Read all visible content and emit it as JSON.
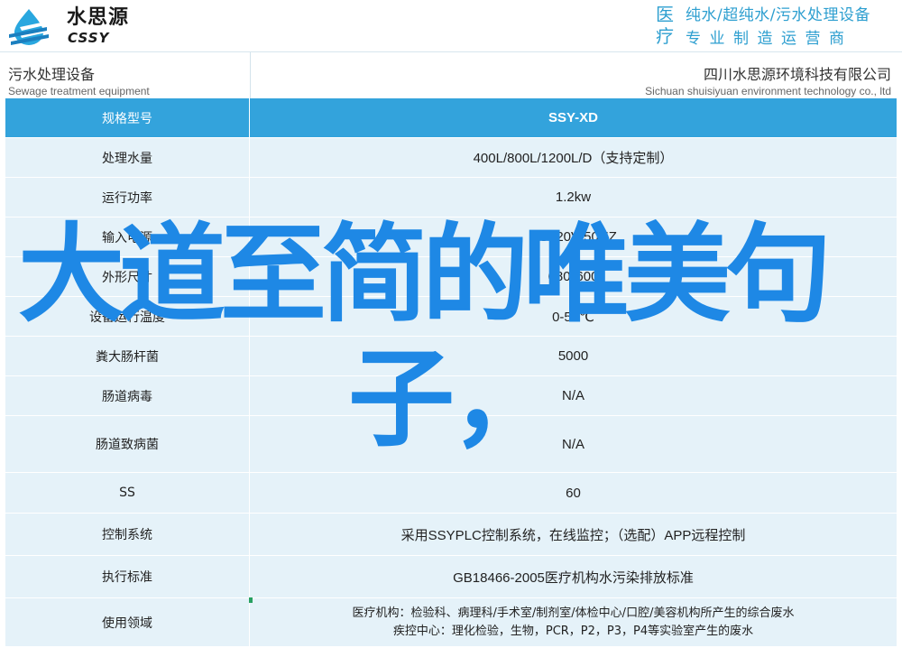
{
  "banner": {
    "logo_cn": "水思源",
    "logo_en": "CSSY",
    "slogan_big": [
      "医",
      "疗"
    ],
    "slogan_line1": "纯水/超纯水/污水处理设备",
    "slogan_line2": "专业制造运营商"
  },
  "header": {
    "left_cn": "污水处理设备",
    "left_en": "Sewage treatment equipment",
    "right_cn": "四川水思源环境科技有限公司",
    "right_en": "Sichuan shuisiyuan environment technology co., ltd"
  },
  "table": {
    "head": {
      "label": "规格型号",
      "value": "SSY-XD"
    },
    "rows": [
      {
        "label": "处理水量",
        "value": "400L/800L/1200L/D（支持定制）"
      },
      {
        "label": "运行功率",
        "value": "1.2kw"
      },
      {
        "label": "输入电源",
        "value": "AC220V/50HZ"
      },
      {
        "label": "外形尺寸",
        "value": "680*600"
      },
      {
        "label": "设备运行温度",
        "value": "0-50℃"
      },
      {
        "label": "粪大肠杆菌",
        "value": "5000"
      },
      {
        "label": "肠道病毒",
        "value": "N/A"
      },
      {
        "label": "肠道致病菌",
        "value": "N/A"
      },
      {
        "label": "SS",
        "value": "60"
      },
      {
        "label": "控制系统",
        "value": "采用SSYPLC控制系统，在线监控；（选配）APP远程控制"
      },
      {
        "label": "执行标准",
        "value": "GB18466-2005医疗机构水污染排放标准"
      },
      {
        "label": "使用领域",
        "value_lines": [
          "医疗机构：检验科、病理科/手术室/制剂室/体检中心/口腔/美容机构所产生的综合废水",
          "疾控中心：理化检验，生物，PCR，P2，P3，P4等实验室产生的废水"
        ]
      }
    ]
  },
  "overlay": {
    "line1": "大道至简的唯美句",
    "line2": "子，"
  },
  "colors": {
    "accent": "#33a3dc",
    "row_bg": "#e5f2f9",
    "headline": "#1e88e5",
    "slogan": "#2e9fd0"
  }
}
